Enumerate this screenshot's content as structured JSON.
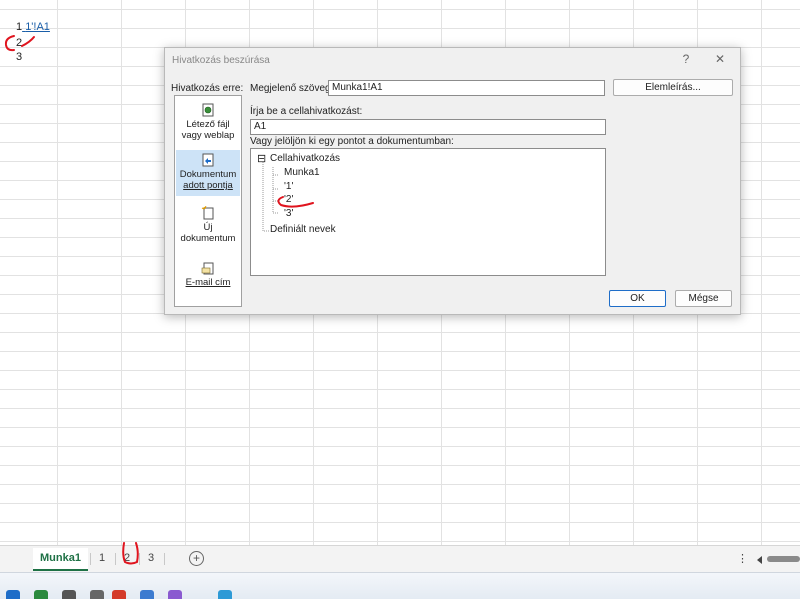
{
  "sheet": {
    "cells": [
      {
        "row": "1",
        "value": "1'!A1",
        "is_link": true
      },
      {
        "row": "2",
        "value": "2",
        "is_link": false
      },
      {
        "row": "3",
        "value": "3",
        "is_link": false
      }
    ]
  },
  "dialog": {
    "title": "Hivatkozás beszúrása",
    "help_icon": "?",
    "close_icon": "✕",
    "link_to_label": "Hivatkozás erre:",
    "display_text_label": "Megjelenő szöveg:",
    "display_text_value": "Munka1!A1",
    "screentip_button": "Elemleírás...",
    "cell_ref_label": "Írja be a cellahivatkozást:",
    "cell_ref_value": "A1",
    "place_label": "Vagy jelöljön ki egy pontot a dokumentumban:",
    "nav": [
      {
        "label_1": "Létező fájl",
        "label_2": "vagy weblap",
        "icon": "globe-file-icon",
        "selected": false
      },
      {
        "label_1": "Dokumentum",
        "label_2": "adott pontja",
        "icon": "document-place-icon",
        "selected": true
      },
      {
        "label_1": "Új",
        "label_2": "dokumentum",
        "icon": "new-document-icon",
        "selected": false
      },
      {
        "label_1": "E-mail cím",
        "label_2": "",
        "icon": "email-icon",
        "selected": false
      }
    ],
    "tree": {
      "expander": "⊟",
      "root": "Cellahivatkozás",
      "children": [
        "Munka1",
        "'1'",
        "'2'",
        "'3'"
      ],
      "defined_names": "Definiált nevek"
    },
    "ok_button": "OK",
    "cancel_button": "Mégse"
  },
  "tabs": {
    "sheets": [
      {
        "name": "Munka1",
        "active": true
      },
      {
        "name": "1",
        "active": false
      },
      {
        "name": "2",
        "active": false
      },
      {
        "name": "3",
        "active": false
      }
    ],
    "add_icon": "+",
    "more_icon": "⋮"
  },
  "colors": {
    "link": "#1a5ea8",
    "annotation": "#e0141e",
    "active_tab": "#1e7145",
    "selection": "#cde3f7",
    "default_button_border": "#1e6dc8"
  }
}
